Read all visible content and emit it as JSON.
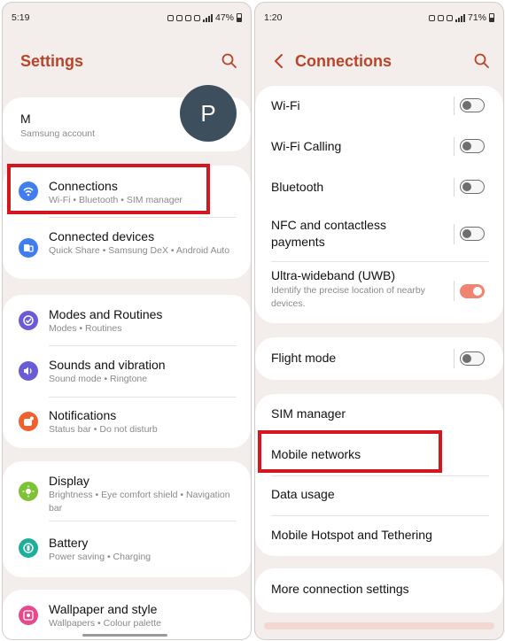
{
  "left": {
    "status": {
      "time": "5:19",
      "battery": "47%"
    },
    "title": "Settings",
    "account": {
      "name": "M",
      "subtitle": "Samsung account",
      "avatar_letter": "P"
    },
    "items": [
      {
        "label": "Connections",
        "sub": "Wi-Fi  •  Bluetooth  •  SIM manager",
        "icon": "wifi-icon",
        "color": "#3f7df0"
      },
      {
        "label": "Connected devices",
        "sub": "Quick Share  •  Samsung DeX  •  Android Auto",
        "icon": "connected-devices-icon",
        "color": "#3f7df0"
      },
      {
        "label": "Modes and Routines",
        "sub": "Modes  •  Routines",
        "icon": "modes-icon",
        "color": "#6a5bd6"
      },
      {
        "label": "Sounds and vibration",
        "sub": "Sound mode  •  Ringtone",
        "icon": "sound-icon",
        "color": "#6a5bd6"
      },
      {
        "label": "Notifications",
        "sub": "Status bar  •  Do not disturb",
        "icon": "notifications-icon",
        "color": "#f0602c"
      },
      {
        "label": "Display",
        "sub": "Brightness  •  Eye comfort shield  •  Navigation bar",
        "icon": "display-icon",
        "color": "#7fc236"
      },
      {
        "label": "Battery",
        "sub": "Power saving  •  Charging",
        "icon": "battery-icon",
        "color": "#1fae9a"
      },
      {
        "label": "Wallpaper and style",
        "sub": "Wallpapers  •  Colour palette",
        "icon": "wallpaper-icon",
        "color": "#e9498a"
      }
    ]
  },
  "right": {
    "status": {
      "time": "1:20",
      "battery": "71%"
    },
    "title": "Connections",
    "toggles": [
      {
        "label": "Wi-Fi",
        "on": false
      },
      {
        "label": "Wi-Fi Calling",
        "on": false
      },
      {
        "label": "Bluetooth",
        "on": false
      },
      {
        "label": "NFC and contactless payments",
        "on": false
      },
      {
        "label": "Ultra-wideband (UWB)",
        "sub": "Identify the precise location of nearby devices.",
        "on": true
      }
    ],
    "flight_mode": {
      "label": "Flight mode",
      "on": false
    },
    "links": [
      "SIM manager",
      "Mobile networks",
      "Data usage",
      "Mobile Hotspot and Tethering"
    ],
    "more": "More connection settings"
  },
  "colors": {
    "accent": "#b94428",
    "highlight": "#d6161f",
    "toggle_on": "#f08470"
  }
}
